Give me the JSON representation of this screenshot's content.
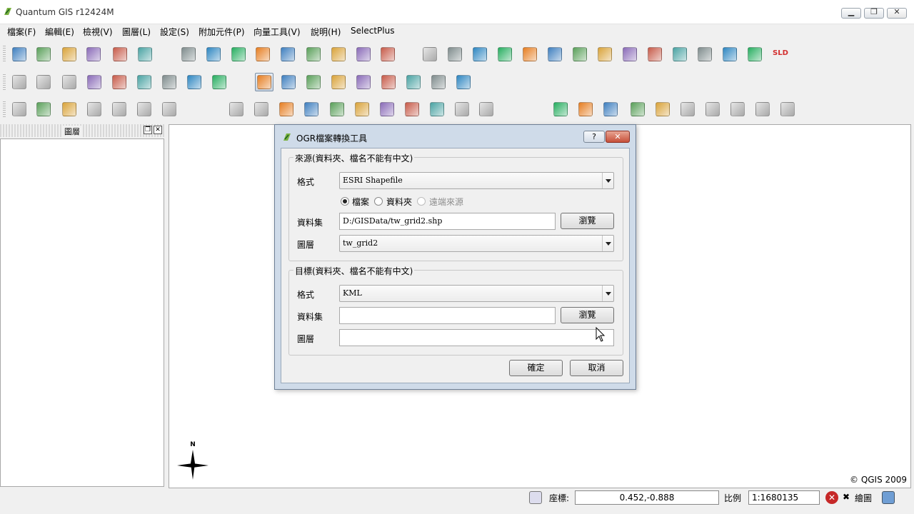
{
  "window": {
    "title": "Quantum GIS r12424M"
  },
  "menu": [
    "檔案(F)",
    "編輯(E)",
    "檢視(V)",
    "圖層(L)",
    "設定(S)",
    "附加元件(P)",
    "向量工具(V)",
    "說明(H)",
    "SelectPlus"
  ],
  "toolbar1_icons": [
    "new-project-icon",
    "open-project-icon",
    "save-project-icon",
    "save-as-icon",
    "print-composer-icon",
    "print-icon",
    "add-vector-layer-icon",
    "add-raster-layer-icon",
    "add-postgis-layer-icon",
    "add-spatialite-layer-icon",
    "add-wms-layer-icon",
    "new-shapefile-icon",
    "remove-layer-icon",
    "add-wfs-layer-icon",
    "gps-icon",
    "copyright-label-icon",
    "scale-bar-icon",
    "d2s-icon",
    "grass-icon",
    "3d-viewer-icon",
    "georeferencer-icon",
    "histogram-icon",
    "label-abc-icon",
    "north-arrow-icon",
    "ogr-converter-icon",
    "database-icon",
    "style-icon",
    "scale-icon",
    "elephant-icon"
  ],
  "toolbar1_text": {
    "sld": "SLD"
  },
  "toolbar2_icons": [
    "identify-icon",
    "select-icon",
    "deselect-icon",
    "attribute-table-icon",
    "measure-line-icon",
    "measure-area-icon",
    "map-tips-icon",
    "home-view-icon",
    "hot-view-icon",
    "pan-hand-icon",
    "zoom-in-icon",
    "zoom-out-icon",
    "zoom-full-icon",
    "zoom-to-selection-icon",
    "zoom-to-layer-icon",
    "zoom-last-icon",
    "zoom-next-icon",
    "refresh-icon"
  ],
  "toolbar3_icons": [
    "edit-pencil-icon",
    "move-feature-icon",
    "node-tool-icon",
    "delete-selected-icon",
    "cut-icon",
    "copy-icon",
    "paste-icon",
    "undo-icon",
    "redo-icon",
    "add-ring-icon",
    "add-island-icon",
    "delete-ring-icon",
    "delete-part-icon",
    "reshape-icon",
    "split-feature-icon",
    "merge-features-icon",
    "simplify-icon",
    "rotate-icon",
    "grass-tools-icon",
    "star-tool-icon",
    "remove-tool-icon",
    "grass-add-icon",
    "grass-edit-icon",
    "region-icon",
    "brush-icon",
    "hammer-icon",
    "book-icon",
    "export-icon"
  ],
  "layers_panel": {
    "title": "圖層"
  },
  "map": {
    "north_label": "N",
    "copyright": "© QGIS 2009"
  },
  "statusbar": {
    "coord_label": "座標:",
    "coord_value": "0.452,-0.888",
    "scale_label": "比例",
    "scale_value": "1:1680135",
    "render_label": "繪圖"
  },
  "dialog": {
    "title": "OGR檔案轉換工具",
    "help": "?",
    "close": "✕",
    "source": {
      "group_title": "來源(資料夾、檔名不能有中文)",
      "format_label": "格式",
      "format_value": "ESRI Shapefile",
      "radios": [
        {
          "label": "檔案",
          "checked": true
        },
        {
          "label": "資料夾",
          "checked": false
        },
        {
          "label": "遠端來源",
          "checked": false
        }
      ],
      "dataset_label": "資料集",
      "dataset_value": "D:/GISData/tw_grid2.shp",
      "browse": "瀏覽",
      "layer_label": "圖層",
      "layer_value": "tw_grid2"
    },
    "target": {
      "group_title": "目標(資料夾、檔名不能有中文)",
      "format_label": "格式",
      "format_value": "KML",
      "dataset_label": "資料集",
      "dataset_value": "",
      "browse": "瀏覽",
      "layer_label": "圖層",
      "layer_value": ""
    },
    "ok": "確定",
    "cancel": "取消"
  }
}
